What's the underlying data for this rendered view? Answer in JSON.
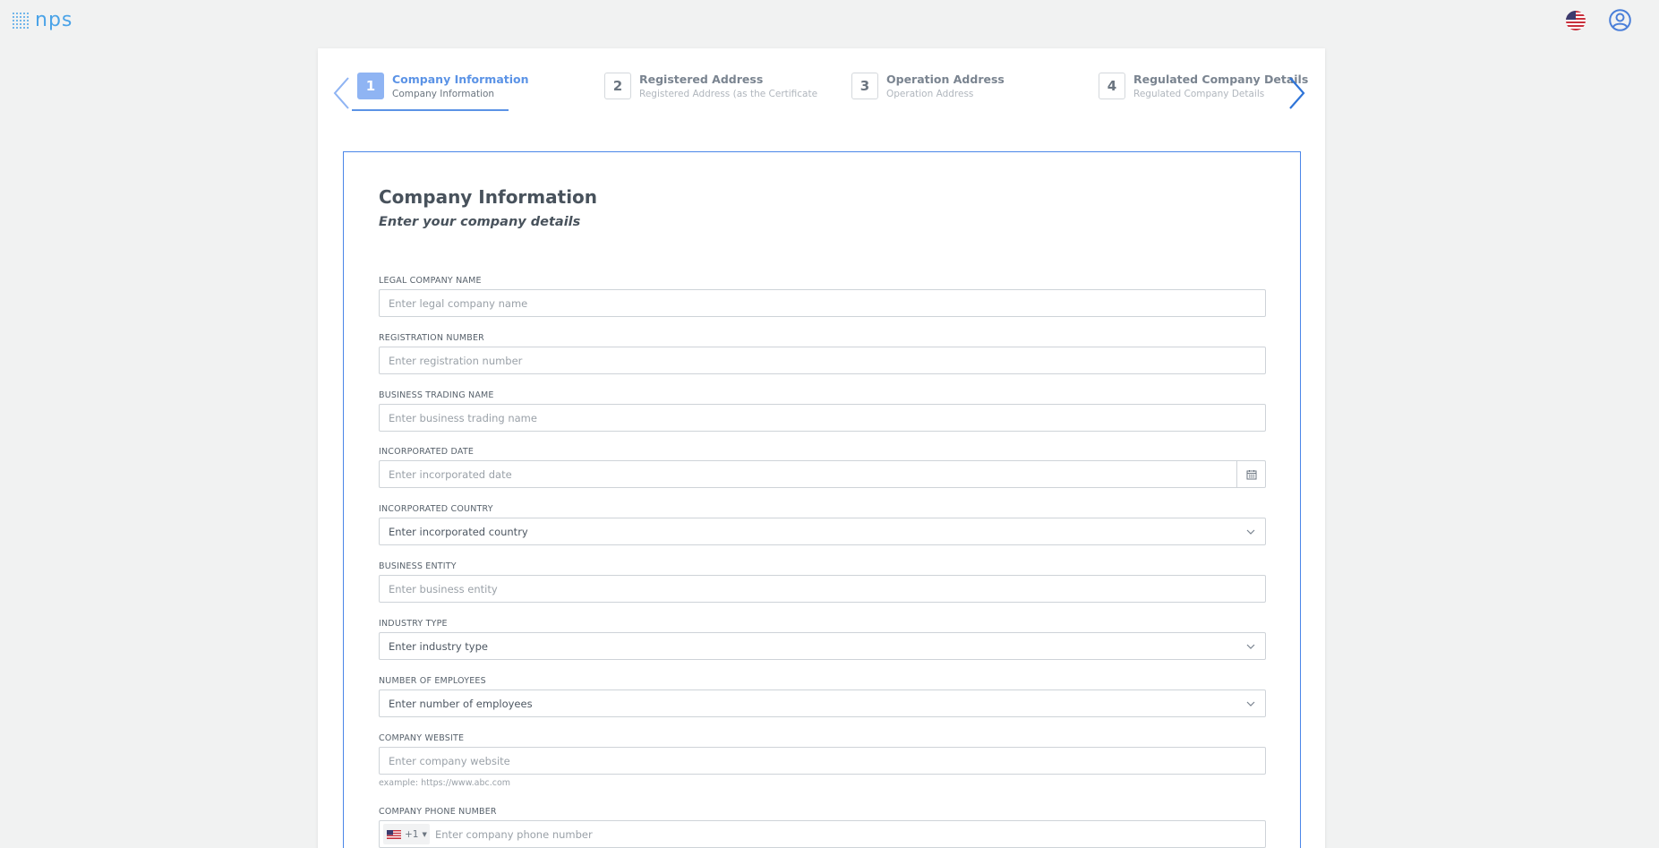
{
  "app": {
    "logo_text": "nps"
  },
  "header": {
    "language_flag": "us-flag-icon",
    "user_icon": "user-avatar-icon"
  },
  "stepper": {
    "steps": [
      {
        "number": "1",
        "title": "Company Information",
        "subtitle": "Company Information"
      },
      {
        "number": "2",
        "title": "Registered Address",
        "subtitle": "Registered Address (as the Certificate"
      },
      {
        "number": "3",
        "title": "Operation Address",
        "subtitle": "Operation Address"
      },
      {
        "number": "4",
        "title": "Regulated Company Details",
        "subtitle": "Regulated Company Details"
      }
    ],
    "active_step": 1
  },
  "form": {
    "title": "Company Information",
    "subtitle": "Enter your company details",
    "fields": {
      "legal_name": {
        "label": "LEGAL COMPANY NAME",
        "placeholder": "Enter legal company name"
      },
      "registration": {
        "label": "REGISTRATION NUMBER",
        "placeholder": "Enter registration number"
      },
      "trading_name": {
        "label": "BUSINESS TRADING NAME",
        "placeholder": "Enter business trading name"
      },
      "incorporated_date": {
        "label": "INCORPORATED DATE",
        "placeholder": "Enter incorporated date"
      },
      "incorporated_country": {
        "label": "INCORPORATED COUNTRY",
        "value": "Enter incorporated country"
      },
      "business_entity": {
        "label": "BUSINESS ENTITY",
        "placeholder": "Enter business entity"
      },
      "industry_type": {
        "label": "INDUSTRY TYPE",
        "value": "Enter industry type"
      },
      "employees": {
        "label": "NUMBER OF EMPLOYEES",
        "value": "Enter number of employees"
      },
      "website": {
        "label": "COMPANY WEBSITE",
        "placeholder": "Enter company website",
        "hint": "example: https://www.abc.com"
      },
      "phone": {
        "label": "COMPANY PHONE NUMBER",
        "dial_code": "+1",
        "placeholder": "Enter company phone number"
      }
    }
  },
  "colors": {
    "accent": "#4a86e8",
    "active_step": "#8fb4f3",
    "background": "#f1f2f2"
  }
}
